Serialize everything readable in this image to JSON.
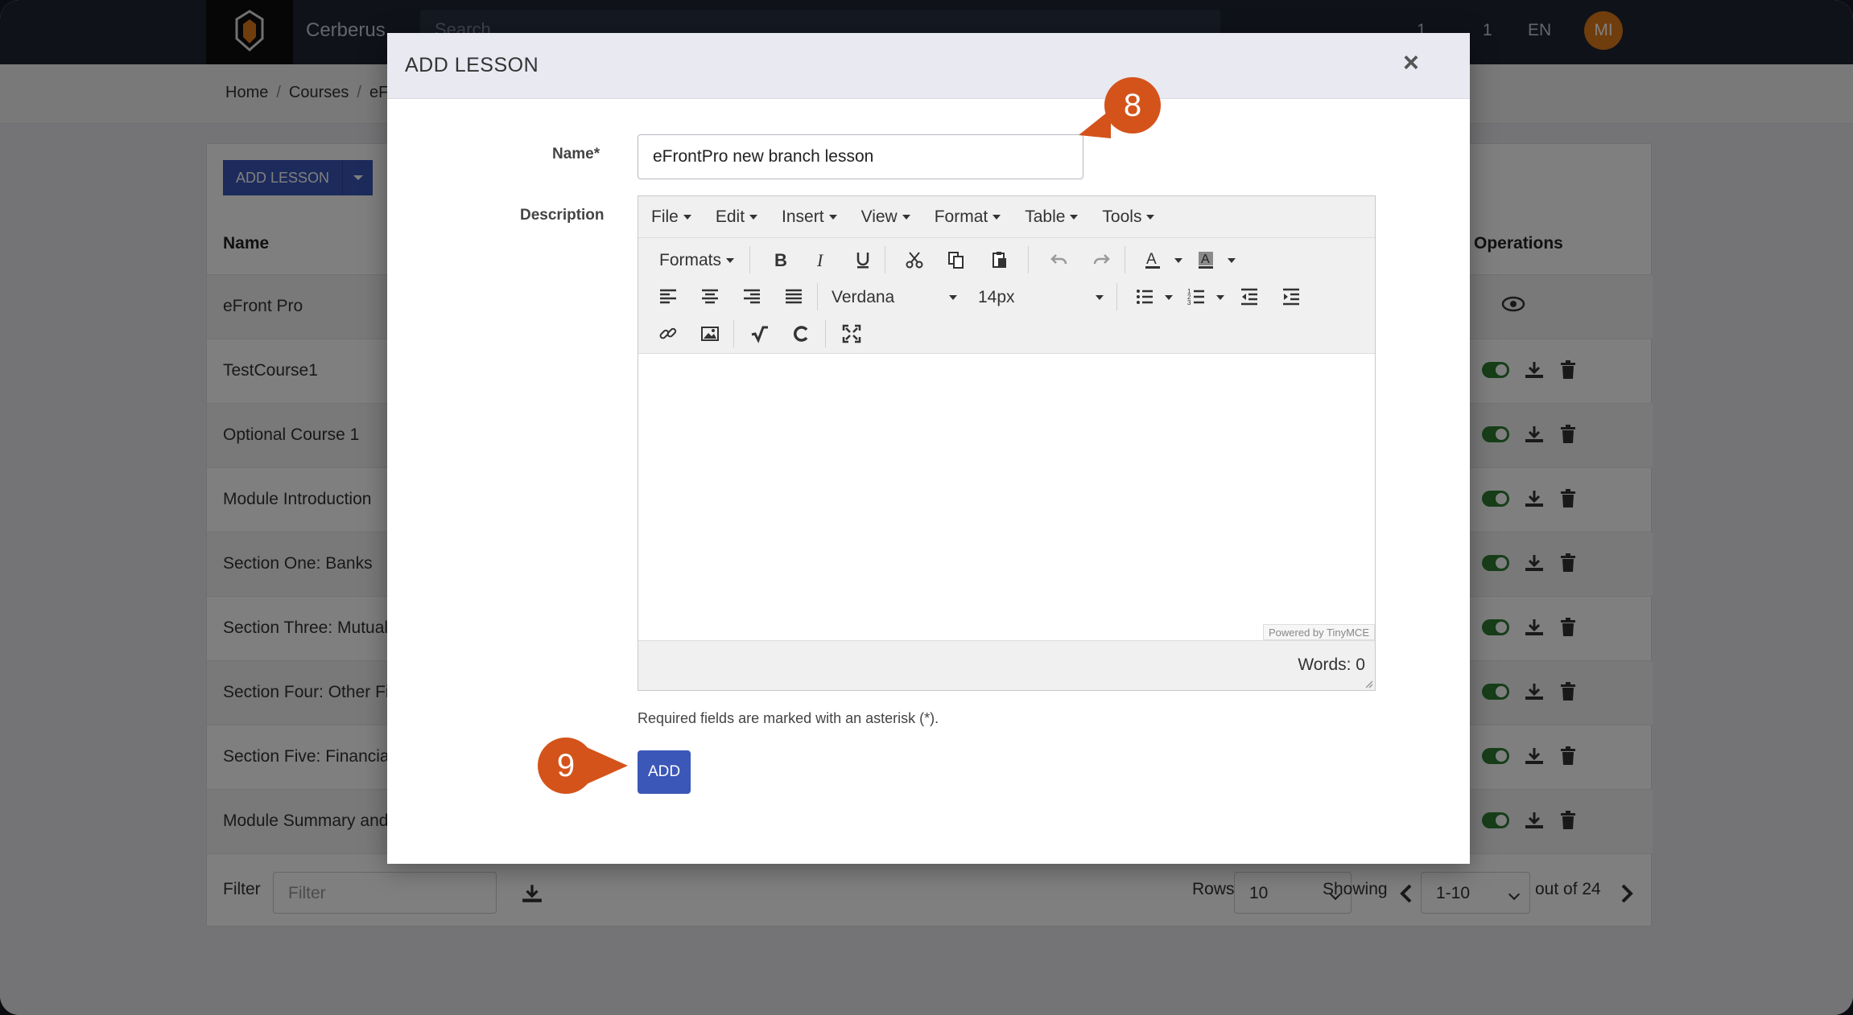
{
  "topbar": {
    "brand": "Cerberus",
    "search_placeholder": "Search",
    "count_a": "1",
    "count_b": "1",
    "lang": "EN",
    "avatar_initials": "MI"
  },
  "breadcrumb": [
    "Home",
    "Courses",
    "eF"
  ],
  "background_list": {
    "add_button": "ADD LESSON",
    "col_name": "Name",
    "col_operations": "Operations",
    "rows": [
      "eFront Pro",
      "TestCourse1",
      "Optional Course 1",
      "Module Introduction",
      "Section One: Banks",
      "Section Three: Mutual",
      "Section Four: Other Fi",
      "Section Five: Financia",
      "Module Summary and"
    ],
    "filter_label": "Filter",
    "filter_placeholder": "Filter",
    "rows_label": "Rows",
    "rows_value": "10",
    "showing_label": "Showing",
    "showing_value": "1-10",
    "out_of": "out of 24"
  },
  "modal": {
    "title": "ADD LESSON",
    "close": "×",
    "name_label": "Name*",
    "name_value": "eFrontPro new branch lesson",
    "description_label": "Description",
    "editor": {
      "menus": [
        "File",
        "Edit",
        "Insert",
        "View",
        "Format",
        "Table",
        "Tools"
      ],
      "formats": "Formats",
      "font": "Verdana",
      "size": "14px",
      "powered": "Powered by TinyMCE",
      "words": "Words: 0"
    },
    "required_note": "Required fields are marked with an asterisk (*).",
    "add_button": "ADD"
  },
  "callouts": {
    "step_a": "8",
    "step_b": "9"
  },
  "colors": {
    "accent": "#3b57b8",
    "callout": "#d4531b",
    "topbar": "#1e2433"
  }
}
